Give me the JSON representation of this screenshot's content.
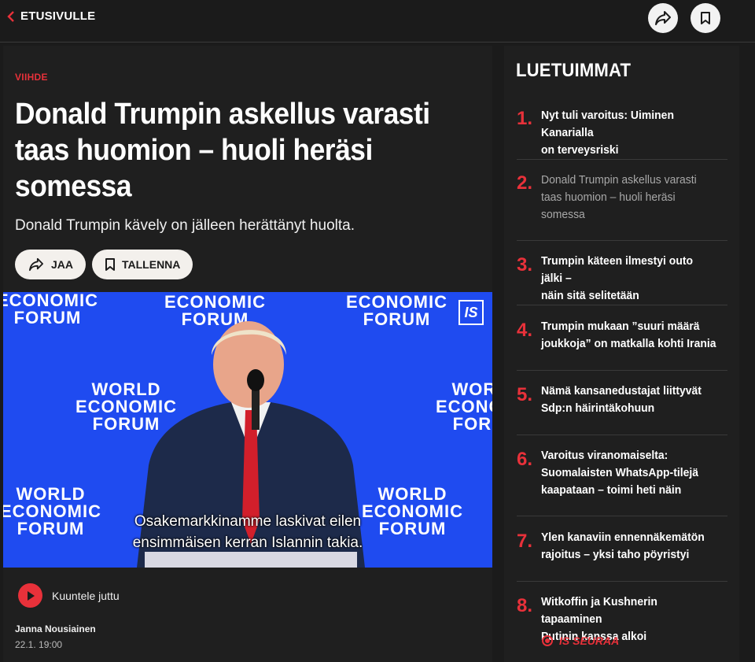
{
  "topbar": {
    "back_label": "ETUSIVULLE",
    "share_icon": "share-arrow-icon",
    "bookmark_icon": "bookmark-icon"
  },
  "article": {
    "section": "VIIHDE",
    "headline_lines": [
      "Donald Trumpin askellus varasti",
      "taas huomion – huoli heräsi",
      "somessa"
    ],
    "lead": "Donald Trumpin kävely on jälleen herättänyt huolta.",
    "share_label": "JAA",
    "save_label": "TALLENNA",
    "video": {
      "caption_lines": [
        "Osakemarkkinamme laskivat eilen",
        "ensimmäisen kerran Islannin takia."
      ],
      "brand_lines": [
        "WORLD",
        "ECONOMIC",
        "FORUM"
      ],
      "logo": "IS"
    },
    "listen_label": "Kuuntele juttu",
    "author": "Janna Nousiainen",
    "date": "22.1. 19:00"
  },
  "sidebar": {
    "title": "LUETUIMMAT",
    "items": [
      {
        "num": "1.",
        "lines": [
          "Nyt tuli varoitus: Uiminen Kanarialla",
          "on terveysriski"
        ],
        "read": false
      },
      {
        "num": "2.",
        "lines": [
          "Donald Trumpin askellus varasti",
          "taas huomion – huoli heräsi",
          "somessa"
        ],
        "read": true
      },
      {
        "num": "3.",
        "lines": [
          "Trumpin käteen ilmestyi outo jälki –",
          "näin sitä selitetään"
        ],
        "read": false
      },
      {
        "num": "4.",
        "lines": [
          "Trumpin mukaan ”suuri määrä",
          "joukkoja” on matkalla kohti Irania"
        ],
        "read": false
      },
      {
        "num": "5.",
        "lines": [
          "Nämä kansanedustajat liittyvät",
          "Sdp:n häirintäkohuun"
        ],
        "read": false
      },
      {
        "num": "6.",
        "lines": [
          "Varoitus viranomaiselta:",
          "Suomalaisten WhatsApp-tilejä",
          "kaapataan – toimi heti näin"
        ],
        "read": false
      },
      {
        "num": "7.",
        "lines": [
          "Ylen kanaviin ennennäkemätön",
          "rajoitus – yksi taho pöyristyi"
        ],
        "read": false
      },
      {
        "num": "8.",
        "lines": [
          "Witkoffin ja Kushnerin tapaaminen",
          "Putinin kanssa alkoi"
        ],
        "read": false
      }
    ],
    "follow_label": "IS SEURAA"
  },
  "colors": {
    "accent": "#e8313a",
    "video_bg": "#1f4bf0",
    "background": "#1b1b1b"
  }
}
